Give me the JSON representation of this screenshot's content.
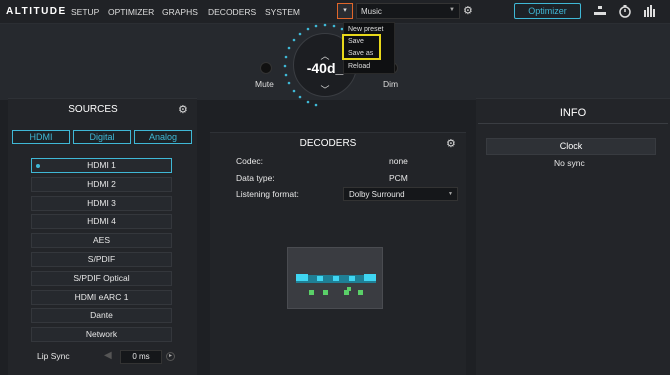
{
  "topbar": {
    "logo": "ALTITUDE",
    "nav": [
      "SETUP",
      "OPTIMIZER",
      "GRAPHS",
      "DECODERS",
      "SYSTEM"
    ],
    "preset_value": "Music",
    "optimizer_label": "Optimizer"
  },
  "preset_menu": {
    "items": [
      "New preset",
      "Save",
      "Save as",
      "Reload"
    ]
  },
  "volume": {
    "value": "-40d_",
    "mute_label": "Mute",
    "dim_label": "Dim"
  },
  "sources": {
    "title": "SOURCES",
    "tabs": [
      "HDMI",
      "Digital",
      "Analog"
    ],
    "items": [
      "HDMI 1",
      "HDMI 2",
      "HDMI 3",
      "HDMI 4",
      "AES",
      "S/PDIF",
      "S/PDIF Optical",
      "HDMI eARC 1",
      "Dante",
      "Network"
    ],
    "lip_sync_label": "Lip Sync",
    "lip_sync_value": "0 ms"
  },
  "decoders": {
    "title": "DECODERS",
    "codec_label": "Codec:",
    "codec_value": "none",
    "datatype_label": "Data type:",
    "datatype_value": "PCM",
    "listening_label": "Listening format:",
    "listening_value": "Dolby Surround"
  },
  "info": {
    "title": "INFO",
    "clock_label": "Clock",
    "sync_status": "No sync"
  },
  "colors": {
    "accent": "#3fb8d6",
    "highlight": "#e8d81a",
    "preset_border": "#e0662a"
  }
}
